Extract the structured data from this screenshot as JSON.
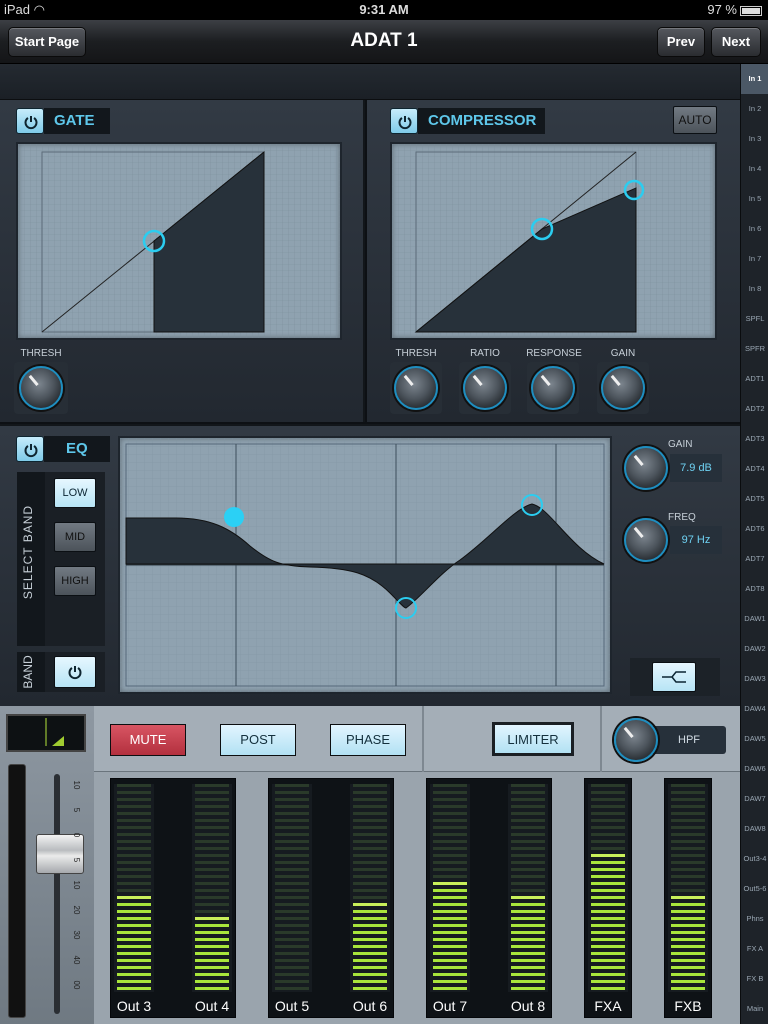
{
  "status": {
    "carrier": "iPad",
    "time": "9:31 AM",
    "battery": "97 %"
  },
  "nav": {
    "title": "ADAT 1",
    "start_page": "Start Page",
    "prev": "Prev",
    "next": "Next"
  },
  "channels": [
    "In 1",
    "In 2",
    "In 3",
    "In 4",
    "In 5",
    "In 6",
    "In 7",
    "In 8",
    "SPFL",
    "SPFR",
    "ADT1",
    "ADT2",
    "ADT3",
    "ADT4",
    "ADT5",
    "ADT6",
    "ADT7",
    "ADT8",
    "DAW1",
    "DAW2",
    "DAW3",
    "DAW4",
    "DAW5",
    "DAW6",
    "DAW7",
    "DAW8",
    "Out3-4",
    "Out5-6",
    "Phns",
    "FX A",
    "FX B",
    "Main"
  ],
  "selected_channel": "In 1",
  "gate": {
    "label": "GATE",
    "thresh_label": "THRESH"
  },
  "compressor": {
    "label": "COMPRESSOR",
    "auto_label": "AUTO",
    "knobs": [
      "THRESH",
      "RATIO",
      "RESPONSE",
      "GAIN"
    ]
  },
  "eq": {
    "label": "EQ",
    "select_band_label": "SELECT BAND",
    "bands": [
      "LOW",
      "MID",
      "HIGH"
    ],
    "selected_band": "LOW",
    "band_label": "BAND",
    "gain_label": "GAIN",
    "gain_value": "7.9 dB",
    "freq_label": "FREQ",
    "freq_value": "97 Hz"
  },
  "strip": {
    "mute": "MUTE",
    "post": "POST",
    "phase": "PHASE",
    "limiter": "LIMITER",
    "hpf": "HPF",
    "fader_scale": [
      "10",
      "5",
      "0",
      "5",
      "10",
      "20",
      "30",
      "40",
      "00"
    ]
  },
  "meters": [
    {
      "label": "Out 3",
      "level": 0.48
    },
    {
      "label": "Out 4",
      "level": 0.38
    },
    {
      "label": "Out 5",
      "level": 0.0
    },
    {
      "label": "Out 6",
      "level": 0.42
    },
    {
      "label": "Out 7",
      "level": 0.52
    },
    {
      "label": "Out 8",
      "level": 0.48
    },
    {
      "label": "FXA",
      "level": 0.67
    },
    {
      "label": "FXB",
      "level": 0.46
    }
  ],
  "colors": {
    "accent": "#5ec7ea",
    "mute": "#c8414e",
    "meter_on": "#a8e53b"
  }
}
